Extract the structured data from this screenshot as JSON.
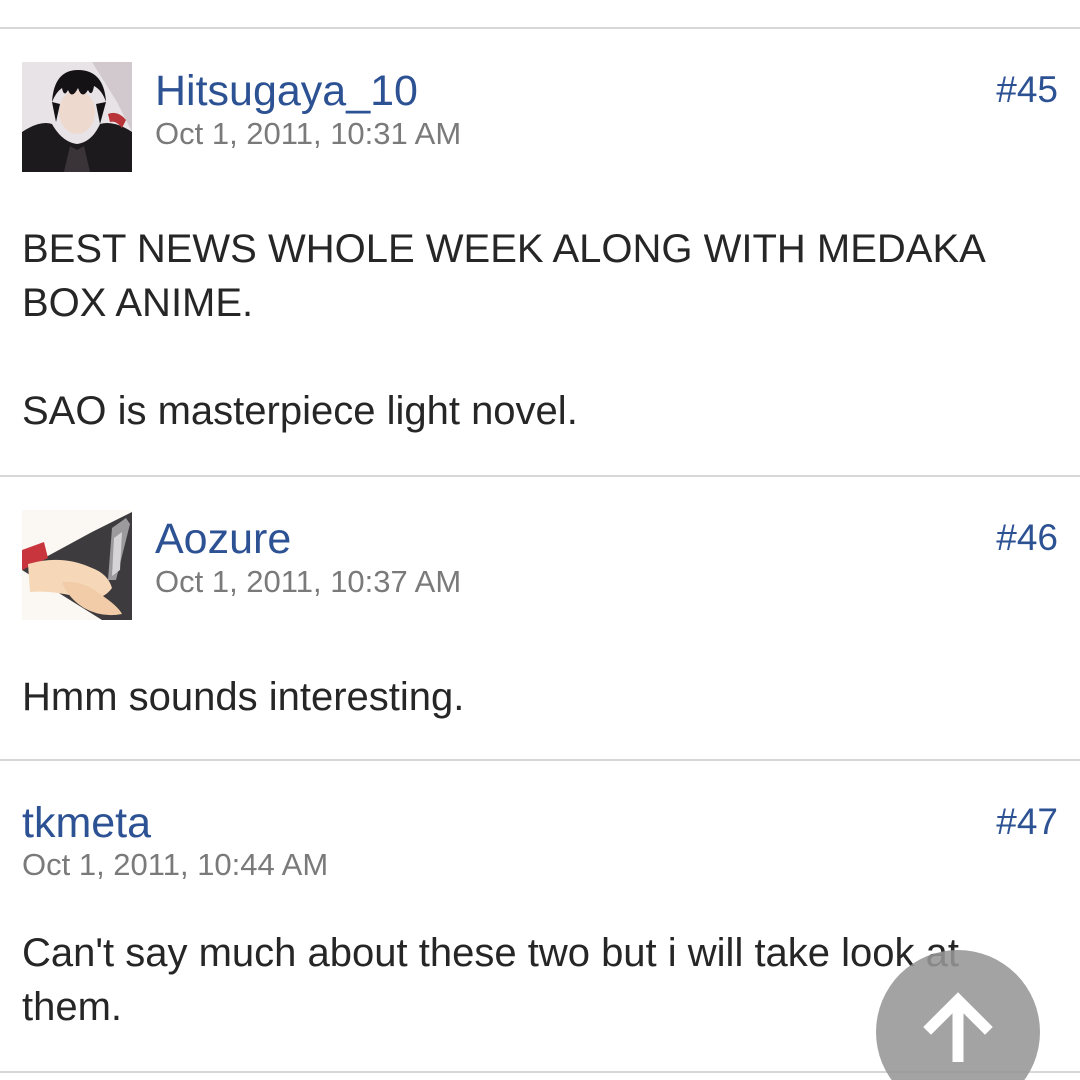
{
  "posts": [
    {
      "username": "Hitsugaya_10",
      "timestamp": "Oct 1, 2011, 10:31 AM",
      "post_number": "#45",
      "has_avatar": true,
      "paragraphs": [
        "BEST NEWS WHOLE WEEK ALONG WITH MEDAKA BOX ANIME.",
        "SAO is masterpiece light novel."
      ]
    },
    {
      "username": "Aozure",
      "timestamp": "Oct 1, 2011, 10:37 AM",
      "post_number": "#46",
      "has_avatar": true,
      "paragraphs": [
        "Hmm sounds interesting."
      ]
    },
    {
      "username": "tkmeta",
      "timestamp": "Oct 1, 2011, 10:44 AM",
      "post_number": "#47",
      "has_avatar": false,
      "paragraphs": [
        "Can't say much about these two but i will take look at them."
      ]
    }
  ],
  "scroll_top_button": {
    "icon": "arrow-up-icon"
  },
  "colors": {
    "link": "#2d5294",
    "timestamp": "#7a7a7a",
    "body_text": "#262626",
    "divider": "#d7d7d7",
    "fab": "#969696"
  }
}
